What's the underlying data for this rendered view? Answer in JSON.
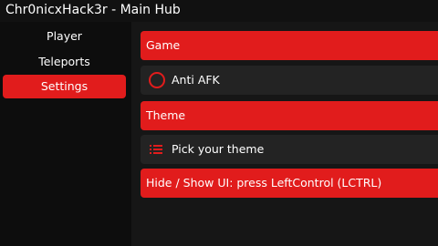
{
  "window": {
    "title": "Chr0nicxHack3r - Main Hub"
  },
  "sidebar": {
    "items": [
      {
        "label": "Player",
        "active": false
      },
      {
        "label": "Teleports",
        "active": false
      },
      {
        "label": "Settings",
        "active": true
      }
    ]
  },
  "main": {
    "game_section": {
      "label": "Game"
    },
    "anti_afk": {
      "label": "Anti AFK",
      "enabled": false,
      "icon": "toggle-circle-icon"
    },
    "theme_section": {
      "label": "Theme"
    },
    "theme_picker": {
      "label": "Pick your theme",
      "icon": "list-icon"
    },
    "hide_show": {
      "label": "Hide / Show UI: press LeftControl (LCTRL)"
    }
  },
  "colors": {
    "accent": "#e11c1c",
    "background": "#161616",
    "sidebar": "#0d0d0d",
    "row": "#232323",
    "text": "#ffffff"
  }
}
